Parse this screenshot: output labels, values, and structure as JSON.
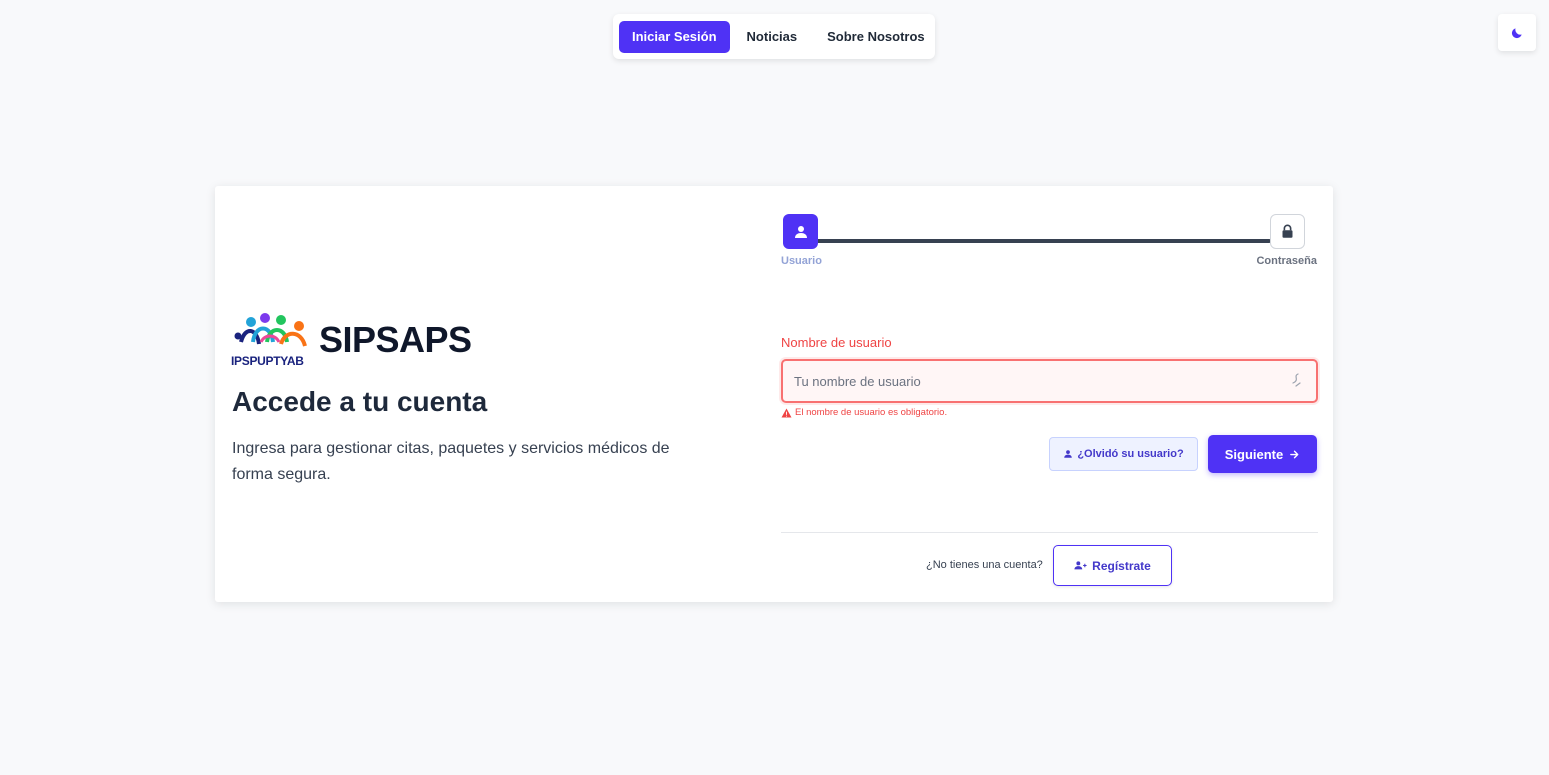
{
  "nav": {
    "items": [
      {
        "label": "Iniciar Sesión",
        "active": true
      },
      {
        "label": "Noticias",
        "active": false
      },
      {
        "label": "Sobre Nosotros",
        "active": false
      }
    ]
  },
  "theme_toggle": {
    "icon": "moon-icon"
  },
  "brand": {
    "logo_text": "IPSPUPTYAB",
    "name": "SIPSAPS"
  },
  "intro": {
    "heading": "Accede a tu cuenta",
    "subtext": "Ingresa para gestionar citas, paquetes y servicios médicos de forma segura."
  },
  "stepper": {
    "steps": [
      {
        "label": "Usuario",
        "icon": "user-icon",
        "active": true
      },
      {
        "label": "Contraseña",
        "icon": "lock-icon",
        "active": false
      }
    ]
  },
  "form": {
    "username_label": "Nombre de usuario",
    "username_placeholder": "Tu nombre de usuario",
    "username_value": "",
    "error": "El nombre de usuario es obligatorio.",
    "forgot_label": "¿Olvidó su usuario?",
    "next_label": "Siguiente"
  },
  "signup": {
    "prompt": "¿No tienes una cuenta?",
    "button_label": "Regístrate"
  },
  "colors": {
    "accent": "#4f32f5",
    "error": "#ef4444",
    "background": "#f8f9fb"
  }
}
